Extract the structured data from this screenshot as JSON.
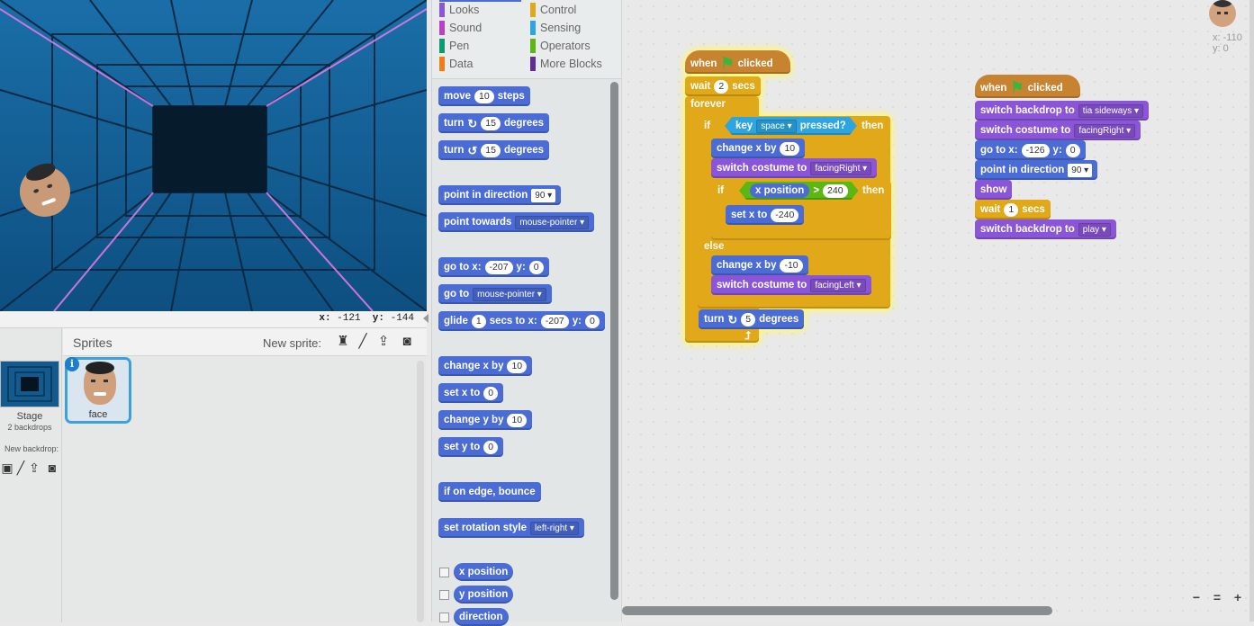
{
  "stage": {
    "coords": {
      "x_label": "x:",
      "x_value": "-121",
      "y_label": "y:",
      "y_value": "-144"
    }
  },
  "sprite_pane": {
    "title": "Sprites",
    "new_sprite_label": "New sprite:",
    "stage_label": "Stage",
    "stage_sub": "2 backdrops",
    "new_backdrop_label": "New backdrop:",
    "sprite_name": "face",
    "info_glyph": "i"
  },
  "categories": {
    "looks": "Looks",
    "sound": "Sound",
    "pen": "Pen",
    "data": "Data",
    "control": "Control",
    "sensing": "Sensing",
    "operators": "Operators",
    "more": "More Blocks",
    "colors": {
      "looks": "#8a55d7",
      "sound": "#bb42c3",
      "pen": "#0e9a6c",
      "data": "#ee7d16",
      "control": "#e1a91a",
      "sensing": "#2ca5e2",
      "operators": "#5cb712",
      "more": "#632d99"
    }
  },
  "palette": {
    "move": {
      "a": "move",
      "v": "10",
      "b": "steps"
    },
    "turn_r": {
      "a": "turn",
      "v": "15",
      "b": "degrees"
    },
    "turn_l": {
      "a": "turn",
      "v": "15",
      "b": "degrees"
    },
    "point_dir": {
      "a": "point in direction",
      "v": "90"
    },
    "point_towards": {
      "a": "point towards",
      "v": "mouse-pointer"
    },
    "goto_xy": {
      "a": "go to x:",
      "x": "-207",
      "b": "y:",
      "y": "0"
    },
    "goto": {
      "a": "go to",
      "v": "mouse-pointer"
    },
    "glide": {
      "a": "glide",
      "v": "1",
      "b": "secs to x:",
      "x": "-207",
      "c": "y:",
      "y": "0"
    },
    "change_x": {
      "a": "change x by",
      "v": "10"
    },
    "set_x": {
      "a": "set x to",
      "v": "0"
    },
    "change_y": {
      "a": "change y by",
      "v": "10"
    },
    "set_y": {
      "a": "set y to",
      "v": "0"
    },
    "bounce": {
      "a": "if on edge, bounce"
    },
    "rot_style": {
      "a": "set rotation style",
      "v": "left-right"
    },
    "rep_x": "x position",
    "rep_y": "y position",
    "rep_dir": "direction"
  },
  "script1": {
    "hat": {
      "a": "when",
      "b": "clicked"
    },
    "wait": {
      "a": "wait",
      "v": "2",
      "b": "secs"
    },
    "forever": "forever",
    "if1": {
      "a": "if",
      "b": "then"
    },
    "key": {
      "a": "key",
      "v": "space",
      "b": "pressed?"
    },
    "change_x_pos": {
      "a": "change x by",
      "v": "10"
    },
    "costume_right": {
      "a": "switch costume to",
      "v": "facingRight"
    },
    "if2": {
      "a": "if",
      "b": "then"
    },
    "gt": {
      "rep": "x position",
      "op": ">",
      "v": "240"
    },
    "set_x": {
      "a": "set x to",
      "v": "-240"
    },
    "else": "else",
    "change_x_neg": {
      "a": "change x by",
      "v": "-10"
    },
    "costume_left": {
      "a": "switch costume to",
      "v": "facingLeft"
    },
    "turn": {
      "a": "turn",
      "v": "5",
      "b": "degrees"
    }
  },
  "script2": {
    "hat": {
      "a": "when",
      "b": "clicked"
    },
    "backdrop1": {
      "a": "switch backdrop to",
      "v": "tia sideways"
    },
    "costume": {
      "a": "switch costume to",
      "v": "facingRight"
    },
    "goto": {
      "a": "go to x:",
      "x": "-126",
      "b": "y:",
      "y": "0"
    },
    "point": {
      "a": "point in direction",
      "v": "90"
    },
    "show": "show",
    "wait": {
      "a": "wait",
      "v": "1",
      "b": "secs"
    },
    "backdrop2": {
      "a": "switch backdrop to",
      "v": "play"
    }
  },
  "scripts_area": {
    "corner_x": "x: -110",
    "corner_y": "y: 0",
    "zoom_out": "−",
    "zoom_reset": "=",
    "zoom_in": "+"
  }
}
